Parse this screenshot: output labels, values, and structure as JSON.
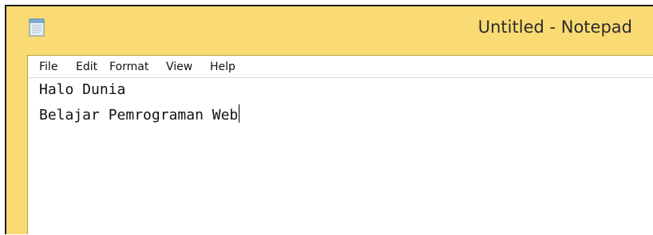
{
  "window": {
    "title": "Untitled - Notepad",
    "icon": "notepad-icon",
    "title_color": "#fadb73"
  },
  "menu": {
    "items": [
      {
        "label": "File"
      },
      {
        "label": "Edit"
      },
      {
        "label": "Format"
      },
      {
        "label": "View"
      },
      {
        "label": "Help"
      }
    ]
  },
  "editor": {
    "lines": [
      "Halo Dunia",
      "Belajar Pemrograman Web"
    ],
    "caret_visible": true
  }
}
